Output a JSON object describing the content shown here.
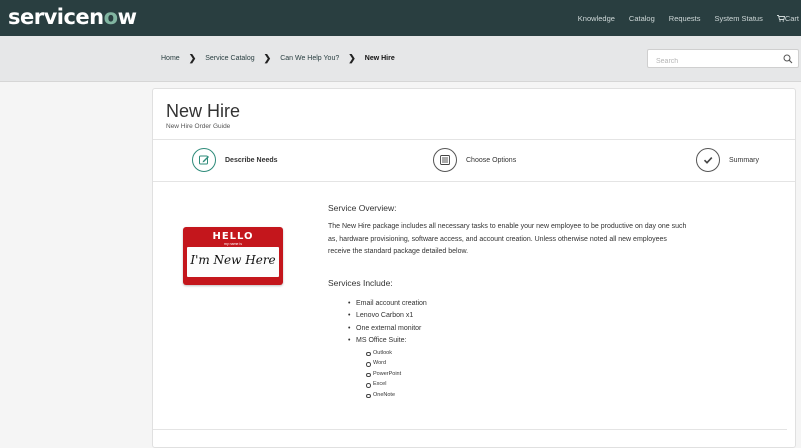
{
  "brand": {
    "logo_prefix": "servicen",
    "logo_o": "o",
    "logo_suffix": "w"
  },
  "nav": {
    "items": [
      "Knowledge",
      "Catalog",
      "Requests",
      "System Status"
    ],
    "cart_label": "Cart",
    "cart_icon": "cart-icon"
  },
  "breadcrumb": {
    "items": [
      "Home",
      "Service Catalog",
      "Can We Help You?"
    ],
    "current": "New Hire",
    "separator_icon": "chevron-right-icon"
  },
  "search": {
    "placeholder": "Search",
    "value": "",
    "icon": "search-icon"
  },
  "page": {
    "title": "New Hire",
    "subtitle": "New Hire Order Guide"
  },
  "steps": [
    {
      "label": "Describe Needs",
      "icon": "edit-icon",
      "active": true
    },
    {
      "label": "Choose Options",
      "icon": "list-icon",
      "active": false
    },
    {
      "label": "Summary",
      "icon": "check-icon",
      "active": false
    }
  ],
  "name_tag": {
    "hello": "HELLO",
    "sub": "my name is",
    "name": "I'm New Here"
  },
  "overview": {
    "heading": "Service Overview:",
    "text": "The New Hire package includes all necessary tasks to enable your new employee to be productive on day one such as, hardware provisioning, software access, and account creation.  Unless otherwise noted all new employees receive the standard package detailed below."
  },
  "services": {
    "heading": "Services Include:",
    "items": [
      "Email account creation",
      "Lenovo Carbon x1",
      "One external monitor",
      "MS Office Suite:"
    ],
    "office_apps": [
      "Outlook",
      "Word",
      "PowerPoint",
      "Excel",
      "OneNote"
    ]
  },
  "colors": {
    "topbar": "#293e40",
    "accent": "#81b5a1",
    "active_step": "#2e8b7a",
    "tag_red": "#c4161c"
  }
}
